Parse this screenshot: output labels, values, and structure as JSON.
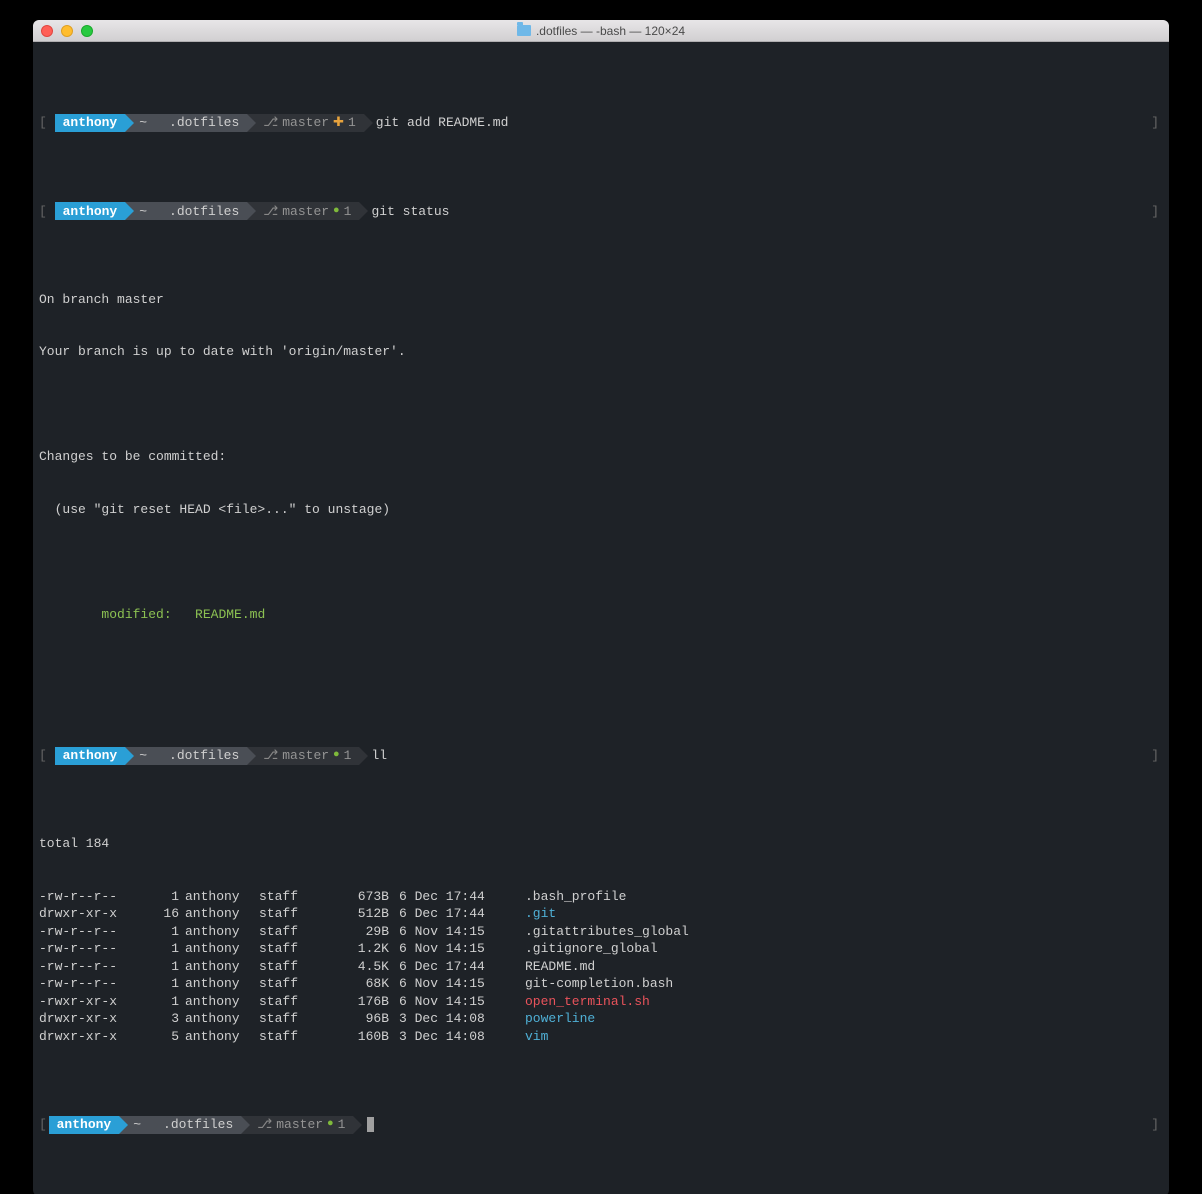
{
  "window": {
    "title": ".dotfiles — -bash — 120×24",
    "folder_icon": "folder-icon"
  },
  "traffic": {
    "close": "close",
    "min": "minimize",
    "max": "maximize"
  },
  "prompt": {
    "user": "anthony",
    "home": "~",
    "dir": ".dotfiles",
    "branch_sym": "⎇",
    "branch": "master",
    "status_plus": "✚",
    "status_dot": "●",
    "count": "1"
  },
  "lines": {
    "cmd1": "git add README.md",
    "cmd2": "git status",
    "out_on_branch": "On branch master",
    "out_uptodate": "Your branch is up to date with 'origin/master'.",
    "out_changes": "Changes to be committed:",
    "out_unstage": "  (use \"git reset HEAD <file>...\" to unstage)",
    "out_modified_label": "modified:",
    "out_modified_file": "README.md",
    "cmd3": "ll",
    "total": "total 184"
  },
  "ls": [
    {
      "perm": "-rw-r--r--",
      "links": "1",
      "user": "anthony",
      "grp": "staff",
      "size": "673B",
      "date": "6 Dec 17:44",
      "name": ".bash_profile",
      "cls": "out-text"
    },
    {
      "perm": "drwxr-xr-x",
      "links": "16",
      "user": "anthony",
      "grp": "staff",
      "size": "512B",
      "date": "6 Dec 17:44",
      "name": ".git",
      "cls": "blue"
    },
    {
      "perm": "-rw-r--r--",
      "links": "1",
      "user": "anthony",
      "grp": "staff",
      "size": "29B",
      "date": "6 Nov 14:15",
      "name": ".gitattributes_global",
      "cls": "out-text"
    },
    {
      "perm": "-rw-r--r--",
      "links": "1",
      "user": "anthony",
      "grp": "staff",
      "size": "1.2K",
      "date": "6 Nov 14:15",
      "name": ".gitignore_global",
      "cls": "out-text"
    },
    {
      "perm": "-rw-r--r--",
      "links": "1",
      "user": "anthony",
      "grp": "staff",
      "size": "4.5K",
      "date": "6 Dec 17:44",
      "name": "README.md",
      "cls": "out-text"
    },
    {
      "perm": "-rw-r--r--",
      "links": "1",
      "user": "anthony",
      "grp": "staff",
      "size": "68K",
      "date": "6 Nov 14:15",
      "name": "git-completion.bash",
      "cls": "out-text"
    },
    {
      "perm": "-rwxr-xr-x",
      "links": "1",
      "user": "anthony",
      "grp": "staff",
      "size": "176B",
      "date": "6 Nov 14:15",
      "name": "open_terminal.sh",
      "cls": "red"
    },
    {
      "perm": "drwxr-xr-x",
      "links": "3",
      "user": "anthony",
      "grp": "staff",
      "size": "96B",
      "date": "3 Dec 14:08",
      "name": "powerline",
      "cls": "blue"
    },
    {
      "perm": "drwxr-xr-x",
      "links": "5",
      "user": "anthony",
      "grp": "staff",
      "size": "160B",
      "date": "3 Dec 14:08",
      "name": "vim",
      "cls": "blue"
    }
  ]
}
